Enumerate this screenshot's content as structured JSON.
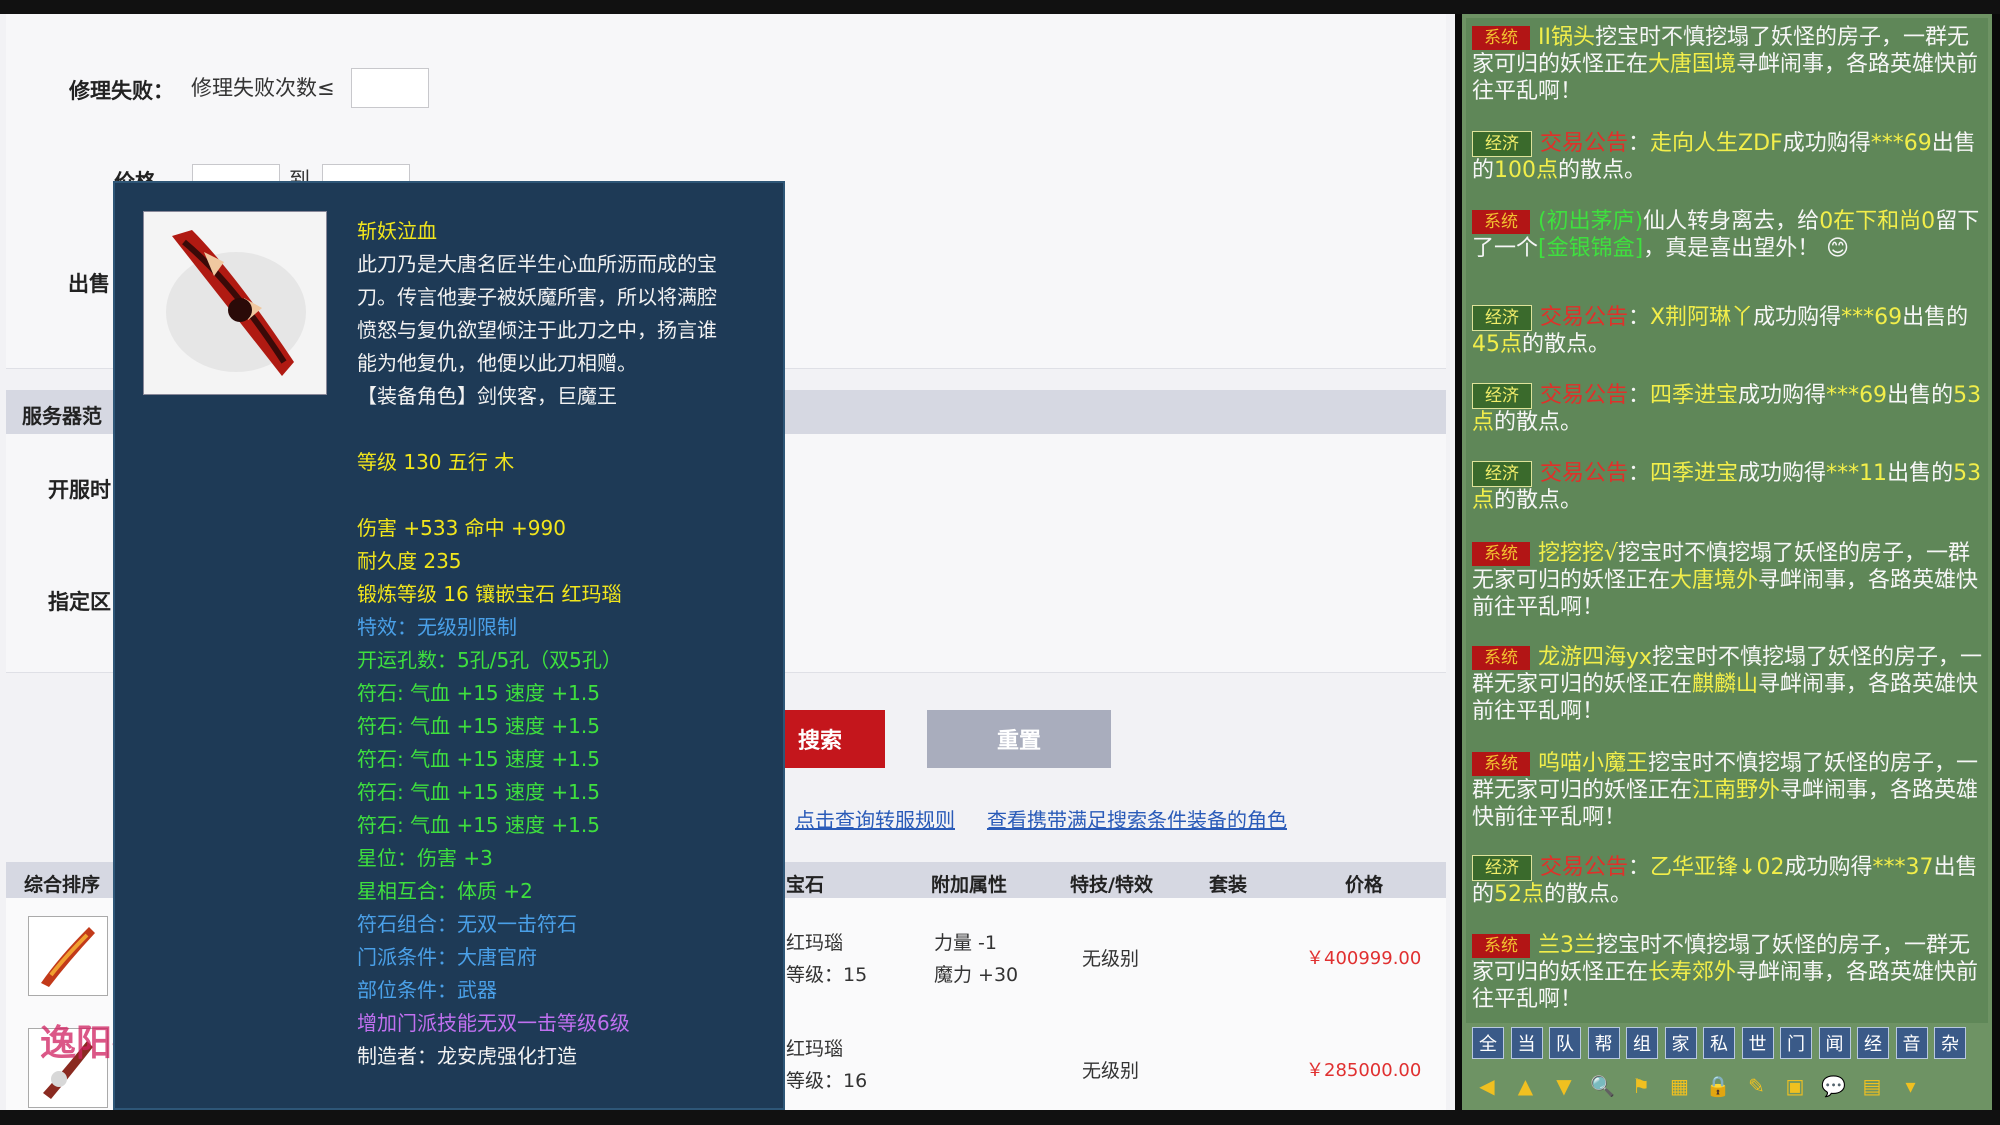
{
  "filters": {
    "repair_fail_label": "修理失败：",
    "repair_fail_text": "修理失败次数≤",
    "price_label": "价格",
    "price_to": "到",
    "sale_label": "出售",
    "server_section": "服务器范",
    "open_label": "开服时",
    "zone_label": "指定区"
  },
  "buttons": {
    "search": "搜索",
    "reset": "重置"
  },
  "links": {
    "transfer_rules": "点击查询转服规则",
    "view_roles": "查看携带满足搜索条件装备的角色"
  },
  "table": {
    "sort_label": "综合排序",
    "headers": [
      "宝石",
      "附加属性",
      "特技/特效",
      "套装",
      "价格"
    ],
    "rows": [
      {
        "gem": "红玛瑙",
        "gem_level": "等级：15",
        "attr1": "力量 -1",
        "attr2": "魔力 +30",
        "effect": "无级别",
        "price": "￥400999.00"
      },
      {
        "gem": "红玛瑙",
        "gem_level": "等级：16",
        "attr1": "",
        "attr2": "",
        "effect": "无级别",
        "price": "￥285000.00"
      }
    ],
    "watermark": "逸阳指"
  },
  "tooltip": {
    "name": "斩妖泣血",
    "desc": [
      "此刀乃是大唐名匠半生心血所沥而成的宝",
      "刀。传言他妻子被妖魔所害，所以将满腔",
      "愤怒与复仇欲望倾注于此刀之中，扬言谁",
      "能为他复仇，他便以此刀相赠。",
      "【装备角色】剑侠客，巨魔王"
    ],
    "level_line": "等级 130 五行 木",
    "stats": [
      "伤害 +533 命中 +990",
      "耐久度 235",
      "锻炼等级 16 镶嵌宝石 红玛瑙"
    ],
    "effect_line": "特效：无级别限制",
    "green_lines": [
      "开运孔数：5孔/5孔（双5孔）",
      "符石: 气血 +15 速度 +1.5",
      "符石: 气血 +15 速度 +1.5",
      "符石: 气血 +15 速度 +1.5",
      "符石: 气血 +15 速度 +1.5",
      "符石: 气血 +15 速度 +1.5",
      "星位：伤害 +3",
      "星相互合：体质 +2"
    ],
    "blue_lines": [
      "符石组合：无双一击符石",
      "门派条件：大唐官府",
      "部位条件：武器"
    ],
    "purple_line": "增加门派技能无双一击等级6级",
    "maker": "制造者：龙安虎强化打造"
  },
  "chat": {
    "sys_badge": "系统",
    "eco_badge": "经济",
    "messages": [
      {
        "type": "sys",
        "parts": [
          [
            "II锅头",
            "cy"
          ],
          [
            "挖宝时不慎挖塌了妖怪的房子，一群无家可归的妖怪正在",
            ""
          ],
          [
            "大唐国境",
            "cy"
          ],
          [
            "寻衅闹事，各路英雄快前往平乱啊！",
            ""
          ]
        ]
      },
      {
        "type": "eco",
        "parts": [
          [
            "交易公告",
            "cr"
          ],
          [
            "：",
            ""
          ],
          [
            "走向人生ZDF",
            "cy"
          ],
          [
            "成功购得",
            ""
          ],
          [
            "***69",
            "cy"
          ],
          [
            "出售的",
            ""
          ],
          [
            "100点",
            "cy"
          ],
          [
            "的散点。",
            ""
          ]
        ]
      },
      {
        "type": "sys",
        "parts": [
          [
            "(初出茅庐)",
            "cg"
          ],
          [
            "仙人转身离去，给",
            ""
          ],
          [
            "0在下和尚0",
            "cy"
          ],
          [
            "留下了一个",
            ""
          ],
          [
            "[金银锦盒]",
            "cg"
          ],
          [
            "，真是喜出望外！ 😊",
            ""
          ]
        ]
      },
      {
        "type": "eco",
        "parts": [
          [
            "交易公告",
            "cr"
          ],
          [
            "：",
            ""
          ],
          [
            "X荆阿琳丫",
            "cy"
          ],
          [
            "成功购得",
            ""
          ],
          [
            "***69",
            "cy"
          ],
          [
            "出售的",
            ""
          ],
          [
            "45点",
            "cy"
          ],
          [
            "的散点。",
            ""
          ]
        ]
      },
      {
        "type": "eco",
        "parts": [
          [
            "交易公告",
            "cr"
          ],
          [
            "：",
            ""
          ],
          [
            "四季进宝",
            "cy"
          ],
          [
            "成功购得",
            ""
          ],
          [
            "***69",
            "cy"
          ],
          [
            "出售的",
            ""
          ],
          [
            "53点",
            "cy"
          ],
          [
            "的散点。",
            ""
          ]
        ]
      },
      {
        "type": "eco",
        "parts": [
          [
            "交易公告",
            "cr"
          ],
          [
            "：",
            ""
          ],
          [
            "四季进宝",
            "cy"
          ],
          [
            "成功购得",
            ""
          ],
          [
            "***11",
            "cy"
          ],
          [
            "出售的",
            ""
          ],
          [
            "53点",
            "cy"
          ],
          [
            "的散点。",
            ""
          ]
        ]
      },
      {
        "type": "sys",
        "parts": [
          [
            "挖挖挖√",
            "cy"
          ],
          [
            "挖宝时不慎挖塌了妖怪的房子，一群无家可归的妖怪正在",
            ""
          ],
          [
            "大唐境外",
            "cy"
          ],
          [
            "寻衅闹事，各路英雄快前往平乱啊！",
            ""
          ]
        ]
      },
      {
        "type": "sys",
        "parts": [
          [
            "龙游四海yx",
            "cy"
          ],
          [
            "挖宝时不慎挖塌了妖怪的房子，一群无家可归的妖怪正在",
            ""
          ],
          [
            "麒麟山",
            "cy"
          ],
          [
            "寻衅闹事，各路英雄快前往平乱啊！",
            ""
          ]
        ]
      },
      {
        "type": "sys",
        "parts": [
          [
            "呜喵小魔王",
            "cy"
          ],
          [
            "挖宝时不慎挖塌了妖怪的房子，一群无家可归的妖怪正在",
            ""
          ],
          [
            "江南野外",
            "cy"
          ],
          [
            "寻衅闹事，各路英雄快前往平乱啊！",
            ""
          ]
        ]
      },
      {
        "type": "eco",
        "parts": [
          [
            "交易公告",
            "cr"
          ],
          [
            "：",
            ""
          ],
          [
            "乙华亚锋↓02",
            "cy"
          ],
          [
            "成功购得",
            ""
          ],
          [
            "***37",
            "cy"
          ],
          [
            "出售的",
            ""
          ],
          [
            "52点",
            "cy"
          ],
          [
            "的散点。",
            ""
          ]
        ]
      },
      {
        "type": "sys",
        "parts": [
          [
            "兰3兰",
            "cy"
          ],
          [
            "挖宝时不慎挖塌了妖怪的房子，一群无家可归的妖怪正在",
            ""
          ],
          [
            "长寿郊外",
            "cy"
          ],
          [
            "寻衅闹事，各路英雄快前往平乱啊！",
            ""
          ]
        ]
      }
    ],
    "tabs": [
      "全",
      "当",
      "队",
      "帮",
      "组",
      "家",
      "私",
      "世",
      "门",
      "闻",
      "经",
      "音",
      "杂"
    ],
    "toolbar_icons": [
      "◀",
      "▲",
      "▼",
      "🔍",
      "⚑",
      "▦",
      "🔒",
      "✎",
      "▣",
      "💬",
      "▤",
      "▾"
    ]
  }
}
